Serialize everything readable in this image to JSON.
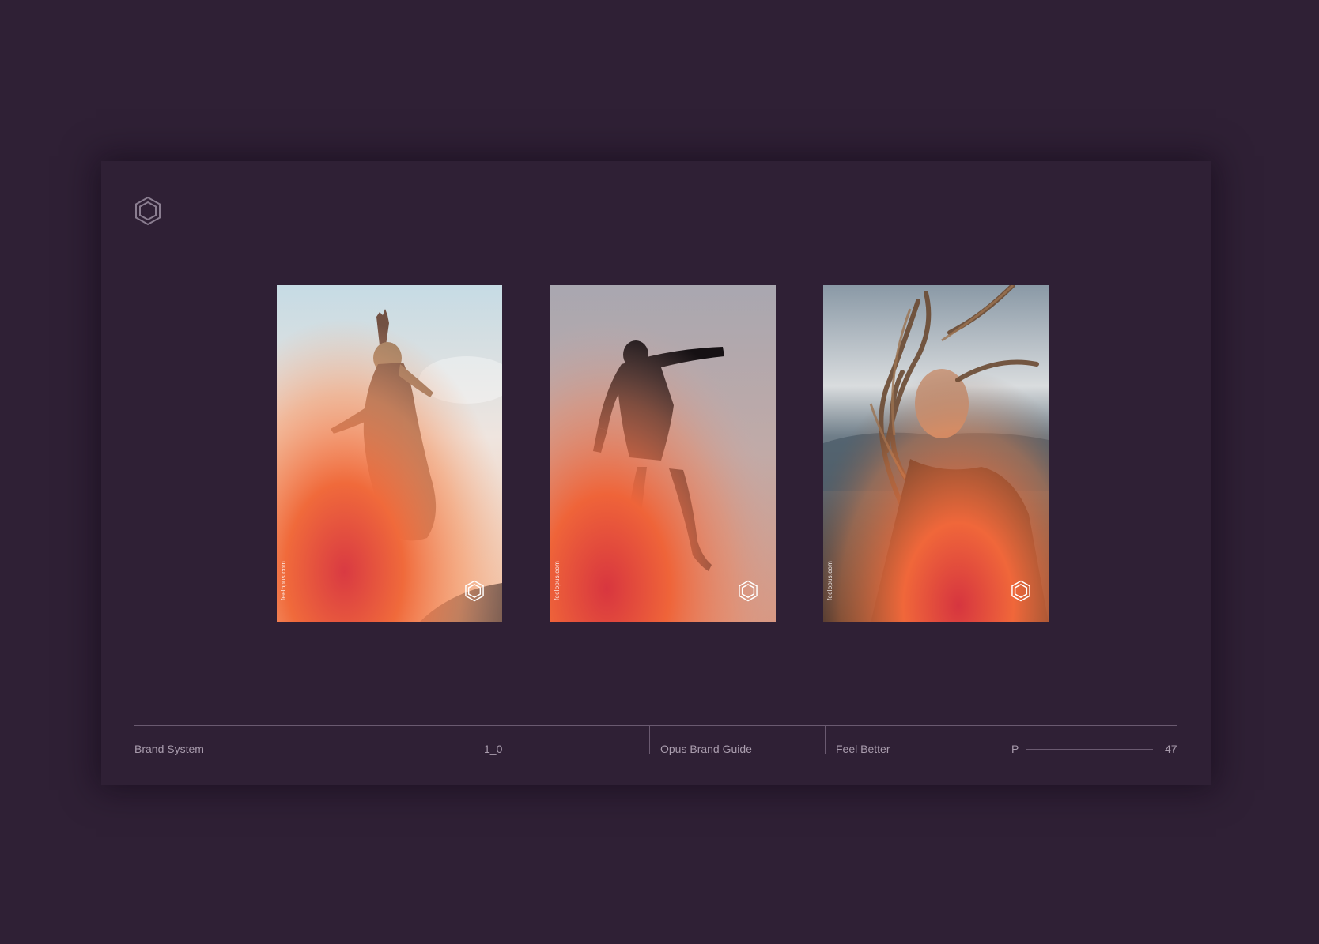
{
  "colors": {
    "background": "#2f2035",
    "text_muted": "#a99cad",
    "rule": "#6a5a70",
    "accent_orange": "#f0693a",
    "accent_red": "#d83a40"
  },
  "header": {
    "logo_icon": "hexagon-logo-icon"
  },
  "posters": [
    {
      "url_text": "feelopus.com",
      "logo_icon": "hexagon-logo-icon",
      "subject": "woman jumping silhouette"
    },
    {
      "url_text": "feelopus.com",
      "logo_icon": "hexagon-logo-icon",
      "subject": "man leaping silhouette"
    },
    {
      "url_text": "feelopus.com",
      "logo_icon": "hexagon-logo-icon",
      "subject": "woman with windblown hair"
    }
  ],
  "footer": {
    "section": "Brand System",
    "version": "1_0",
    "document": "Opus Brand Guide",
    "tagline": "Feel Better",
    "page_prefix": "P",
    "page_number": "47"
  }
}
